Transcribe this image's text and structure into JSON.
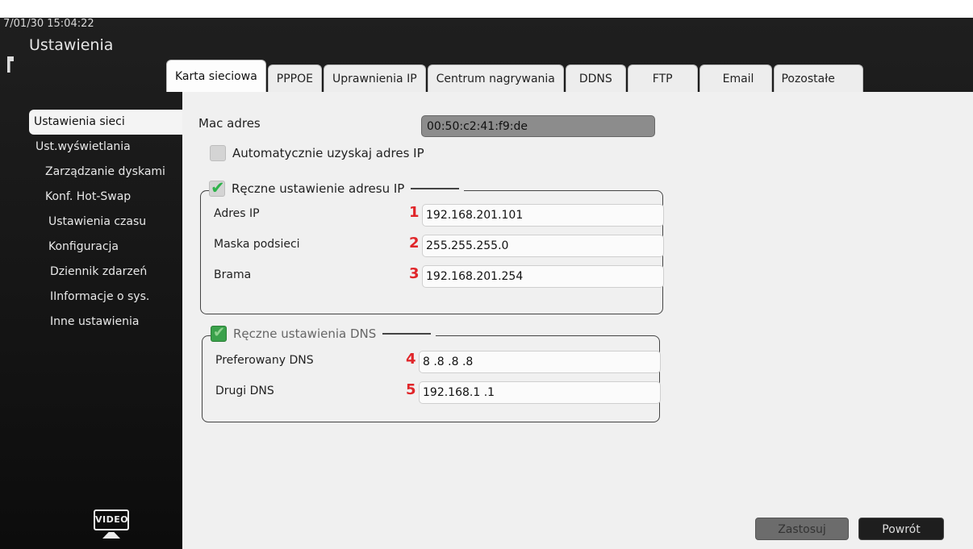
{
  "header": {
    "datetime": "7/01/30 15:04:22",
    "title": "Ustawienia"
  },
  "tabs": [
    {
      "label": "Karta sieciowa",
      "active": true
    },
    {
      "label": "PPPOE"
    },
    {
      "label": "Uprawnienia IP"
    },
    {
      "label": "Centrum nagrywania"
    },
    {
      "label": "DDNS"
    },
    {
      "label": "FTP"
    },
    {
      "label": "Email"
    },
    {
      "label": "Pozostałe"
    }
  ],
  "sidebar": {
    "items": [
      {
        "label": "Ustawienia sieci",
        "active": true
      },
      {
        "label": "Ust.wyświetlania"
      },
      {
        "label": "Zarządzanie dyskami"
      },
      {
        "label": "Konf. Hot-Swap"
      },
      {
        "label": "Ustawienia czasu"
      },
      {
        "label": "Konfiguracja"
      },
      {
        "label": "Dziennik zdarzeń"
      },
      {
        "label": "IInformacje o sys."
      },
      {
        "label": "Inne ustawienia"
      }
    ],
    "logo_text": "VIDEO"
  },
  "network": {
    "mac_label": "Mac adres",
    "mac_value": "00:50:c2:41:f9:de",
    "auto_ip_label": "Automatycznie uzyskaj adres IP",
    "manual_ip_label": "Ręczne ustawienie adresu IP",
    "ip_rows": [
      {
        "label": "Adres IP",
        "num": "1",
        "value": "192.168.201.101"
      },
      {
        "label": "Maska podsieci",
        "num": "2",
        "value": "255.255.255.0"
      },
      {
        "label": "Brama",
        "num": "3",
        "value": "192.168.201.254"
      }
    ],
    "manual_dns_label": "Ręczne ustawienia DNS",
    "dns_rows": [
      {
        "label": "Preferowany DNS",
        "num": "4",
        "value": "8 .8 .8 .8"
      },
      {
        "label": "Drugi DNS",
        "num": "5",
        "value": "192.168.1 .1"
      }
    ]
  },
  "buttons": {
    "apply": "Zastosuj",
    "back": "Powrót"
  },
  "colors": {
    "annotation_red": "#e0262a",
    "check_green": "#2eb24a",
    "panel_bg": "#f0f0f0"
  }
}
